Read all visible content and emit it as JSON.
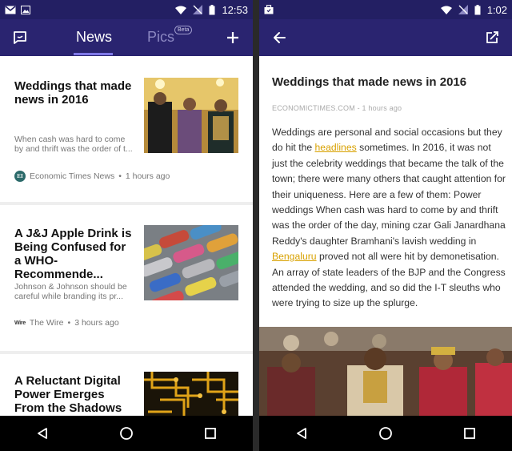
{
  "left": {
    "status": {
      "time": "12:53"
    },
    "appbar": {
      "tabs": [
        {
          "label": "News",
          "active": true
        },
        {
          "label": "Pics",
          "active": false,
          "badge": "Beta"
        }
      ]
    },
    "cards": [
      {
        "title": "Weddings that made news in 2016",
        "snippet": "When cash was hard to come by and thrift was the order of t...",
        "source": "Economic Times News",
        "source_logo": "EI",
        "time": "1 hours ago"
      },
      {
        "title": "A J&J Apple Drink is Being Confused for a WHO-Recommende...",
        "snippet": "Johnson & Johnson should be careful while branding its pr...",
        "source": "The Wire",
        "source_logo": "Wire",
        "time": "3 hours ago"
      },
      {
        "title": "A Reluctant Digital Power Emerges From the Shadows"
      }
    ]
  },
  "right": {
    "status": {
      "time": "1:02"
    },
    "article": {
      "title": "Weddings that made news in 2016",
      "meta": "ECONOMICTIMES.COM - 1 hours ago",
      "body_1": "Weddings are personal and social occasions but they do hit the ",
      "link_1": "headlines",
      "body_2": " sometimes. In 2016, it was not just the celebrity weddings that became the talk of the town; there were many others that caught attention for their uniqueness. Here are a few of them: Power weddings When cash was hard to come by and thrift was the order of the day, mining czar Gali Janardhana Reddy's daughter Bramhani's lavish wedding in ",
      "link_2": "Bengaluru",
      "body_3": " proved not all were hit by demonetisation. An array of state leaders of the BJP and the Congress attended the wedding, and so did the I-T sleuths who were trying to size up the splurge."
    }
  },
  "colors": {
    "statusbar": "#231f63",
    "appbar": "#2a2470",
    "tab_indicator": "#7e77e6",
    "link": "#d8a100"
  },
  "icons": {
    "left_appbar": [
      "chat-icon",
      "plus-icon"
    ],
    "right_appbar": [
      "back-arrow-icon",
      "share-edit-icon"
    ],
    "navbar": [
      "back-triangle-icon",
      "home-circle-icon",
      "recents-square-icon"
    ]
  }
}
